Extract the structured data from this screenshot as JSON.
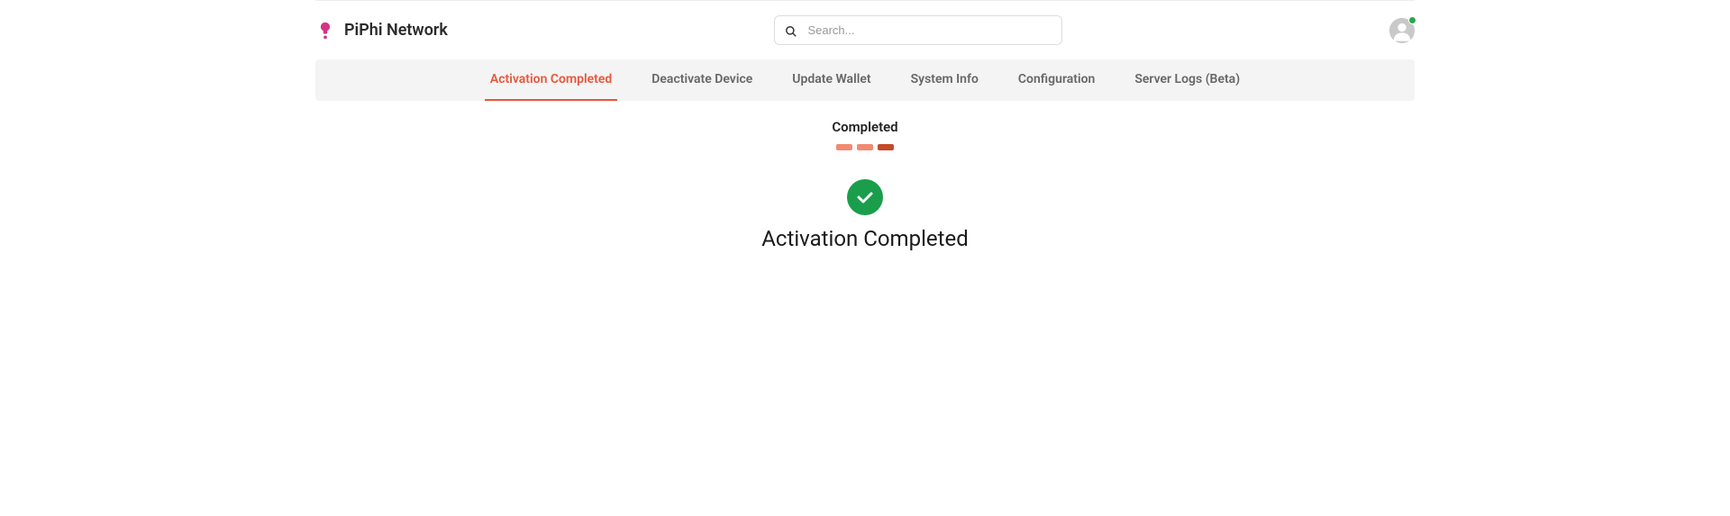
{
  "header": {
    "brand": "PiPhi Network",
    "search_placeholder": "Search..."
  },
  "tabs": [
    {
      "label": "Activation Completed",
      "active": true
    },
    {
      "label": "Deactivate Device",
      "active": false
    },
    {
      "label": "Update Wallet",
      "active": false
    },
    {
      "label": "System Info",
      "active": false
    },
    {
      "label": "Configuration",
      "active": false
    },
    {
      "label": "Server Logs (Beta)",
      "active": false
    }
  ],
  "content": {
    "completed_label": "Completed",
    "status_heading": "Activation Completed"
  }
}
